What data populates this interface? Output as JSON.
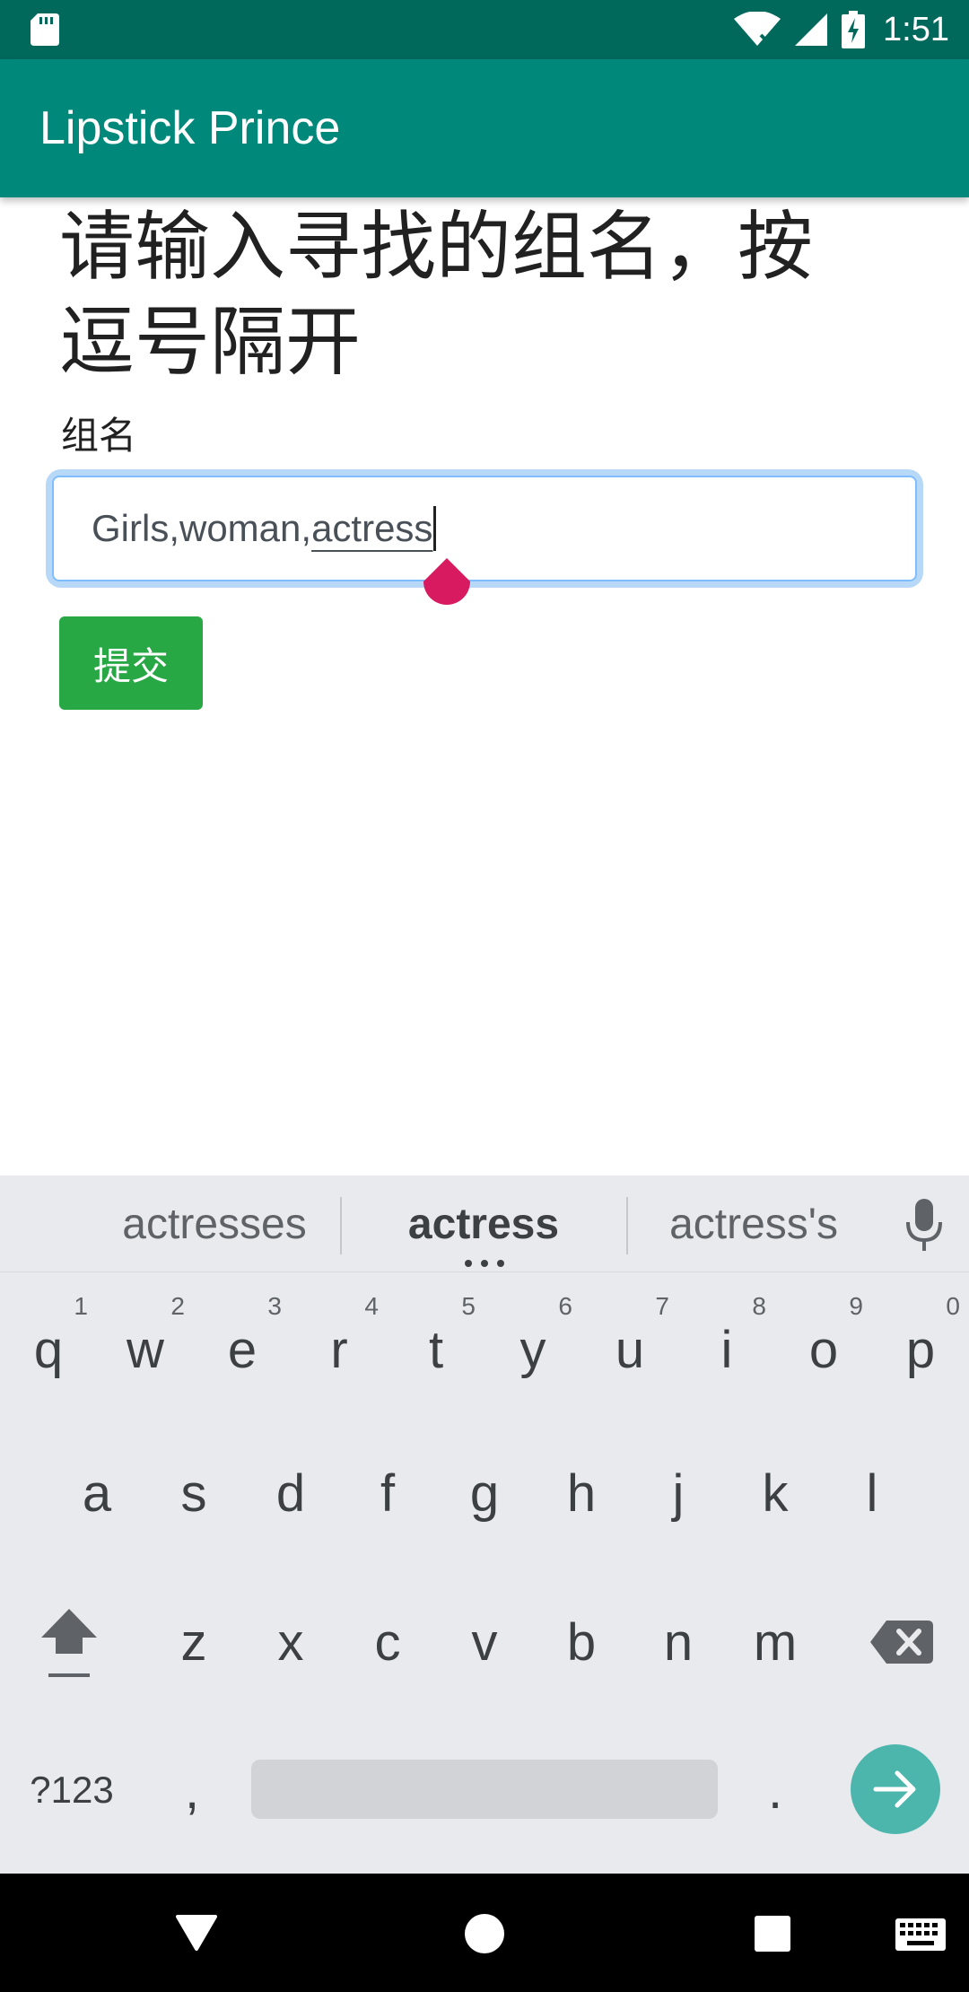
{
  "status_bar": {
    "time": "1:51",
    "icons": [
      "sd-card-icon",
      "wifi-icon",
      "signal-icon",
      "battery-charging-icon"
    ]
  },
  "app_bar": {
    "title": "Lipstick Prince",
    "color": "#00897b"
  },
  "form": {
    "heading_line1": "请输入寻找的组名，按",
    "heading_line2": "逗号隔开",
    "field_label": "组名",
    "input_prefix": "Girls,woman,",
    "input_composing": "actress",
    "submit_label": "提交",
    "submit_color": "#28a745"
  },
  "keyboard": {
    "suggestions": [
      "actresses",
      "actress",
      "actress's"
    ],
    "row1": [
      {
        "key": "q",
        "hint": "1"
      },
      {
        "key": "w",
        "hint": "2"
      },
      {
        "key": "e",
        "hint": "3"
      },
      {
        "key": "r",
        "hint": "4"
      },
      {
        "key": "t",
        "hint": "5"
      },
      {
        "key": "y",
        "hint": "6"
      },
      {
        "key": "u",
        "hint": "7"
      },
      {
        "key": "i",
        "hint": "8"
      },
      {
        "key": "o",
        "hint": "9"
      },
      {
        "key": "p",
        "hint": "0"
      }
    ],
    "row2": [
      "a",
      "s",
      "d",
      "f",
      "g",
      "h",
      "j",
      "k",
      "l"
    ],
    "row3": [
      "z",
      "x",
      "c",
      "v",
      "b",
      "n",
      "m"
    ],
    "symbols_label": "?123",
    "comma_label": ",",
    "period_label": ".",
    "accent_color": "#4db6ac"
  },
  "nav_bar": {
    "icons": [
      "back-icon",
      "home-icon",
      "recents-icon",
      "keyboard-switch-icon"
    ]
  }
}
